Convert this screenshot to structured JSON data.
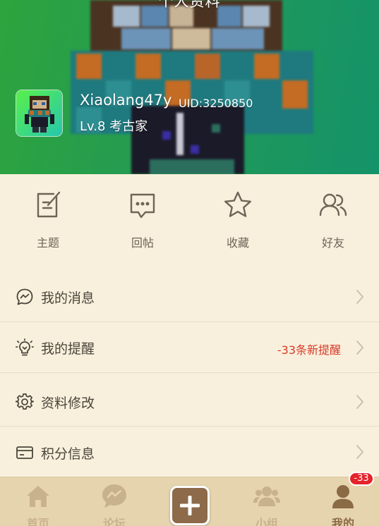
{
  "header": {
    "title": "个人资料",
    "more_label": "···"
  },
  "user": {
    "name": "Xiaolang47y",
    "uid": "UID:3250850",
    "level": "Lv.8 考古家"
  },
  "quick_actions": [
    {
      "label": "主题",
      "icon": "edit-note-icon"
    },
    {
      "label": "回帖",
      "icon": "comment-dots-icon"
    },
    {
      "label": "收藏",
      "icon": "star-icon"
    },
    {
      "label": "好友",
      "icon": "friends-icon"
    }
  ],
  "menu": [
    {
      "label": "我的消息",
      "icon": "message-icon",
      "note": ""
    },
    {
      "label": "我的提醒",
      "icon": "bulb-icon",
      "note": "-33条新提醒"
    },
    {
      "label": "资料修改",
      "icon": "settings-icon",
      "note": ""
    },
    {
      "label": "积分信息",
      "icon": "card-icon",
      "note": ""
    }
  ],
  "tabbar": {
    "tabs": [
      {
        "label": "首页",
        "icon": "home-icon",
        "active": false
      },
      {
        "label": "论坛",
        "icon": "chat-icon",
        "active": false
      },
      {
        "label": "",
        "icon": "plus-icon",
        "active": false
      },
      {
        "label": "小组",
        "icon": "group-icon",
        "active": false
      },
      {
        "label": "我的",
        "icon": "user-icon",
        "active": true
      }
    ],
    "profile_badge": "-33"
  },
  "colors": {
    "background": "#f8f0dc",
    "banner_green": "#239a53",
    "tab_bar": "#e6d4ae",
    "accent_brown": "#8c6a4a",
    "alert_red": "#e5232b"
  }
}
